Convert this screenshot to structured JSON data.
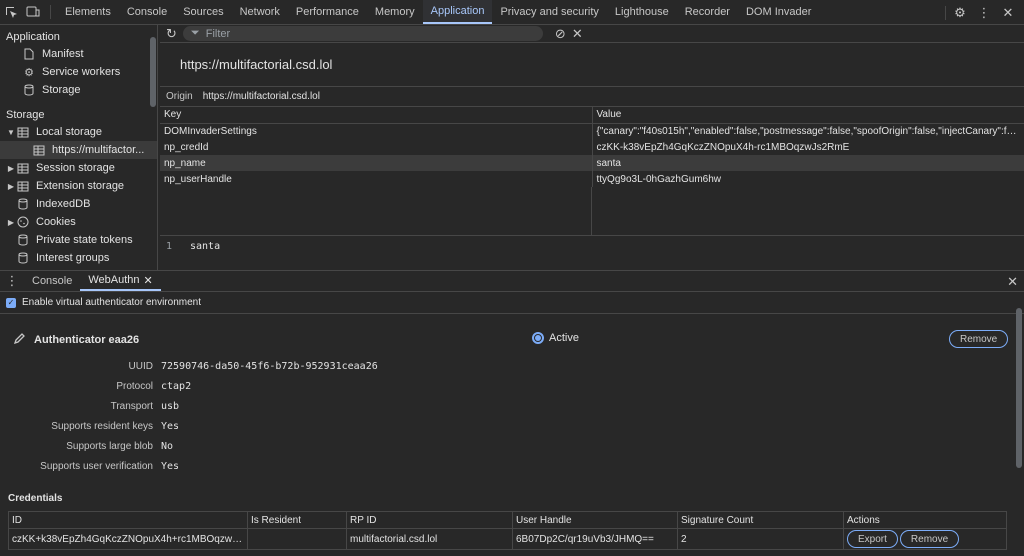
{
  "topbar": {
    "tabs": [
      "Elements",
      "Console",
      "Sources",
      "Network",
      "Performance",
      "Memory",
      "Application",
      "Privacy and security",
      "Lighthouse",
      "Recorder",
      "DOM Invader"
    ],
    "active_tab": "Application"
  },
  "sidebar": {
    "application_heading": "Application",
    "app_items": [
      "Manifest",
      "Service workers",
      "Storage"
    ],
    "storage_heading": "Storage",
    "local_storage": "Local storage",
    "local_storage_child": "https://multifactor...",
    "session_storage": "Session storage",
    "extension_storage": "Extension storage",
    "indexeddb": "IndexedDB",
    "cookies": "Cookies",
    "private_state_tokens": "Private state tokens",
    "interest_groups": "Interest groups"
  },
  "main": {
    "filter_placeholder": "Filter",
    "origin_url": "https://multifactorial.csd.lol",
    "origin_label": "Origin",
    "origin_value": "https://multifactorial.csd.lol",
    "col_key": "Key",
    "col_value": "Value",
    "rows": [
      {
        "key": "DOMInvaderSettings",
        "value": "{\"canary\":\"f40s015h\",\"enabled\":false,\"postmessage\":false,\"spoofOrigin\":false,\"injectCanary\":fals..."
      },
      {
        "key": "np_credId",
        "value": "czKK-k38vEpZh4GqKczZNOpuX4h-rc1MBOqzwJs2RmE"
      },
      {
        "key": "np_name",
        "value": "santa"
      },
      {
        "key": "np_userHandle",
        "value": "ttyQg9o3L-0hGazhGum6hw"
      }
    ],
    "preview_line": "1",
    "preview_text": "santa"
  },
  "drawer": {
    "tabs": [
      "Console",
      "WebAuthn"
    ],
    "active_tab": "WebAuthn",
    "enable_label": "Enable virtual authenticator environment",
    "authenticator_name": "Authenticator eaa26",
    "active_label": "Active",
    "remove_label": "Remove",
    "props": [
      {
        "k": "UUID",
        "v": "72590746-da50-45f6-b72b-952931ceaa26"
      },
      {
        "k": "Protocol",
        "v": "ctap2"
      },
      {
        "k": "Transport",
        "v": "usb"
      },
      {
        "k": "Supports resident keys",
        "v": "Yes"
      },
      {
        "k": "Supports large blob",
        "v": "No"
      },
      {
        "k": "Supports user verification",
        "v": "Yes"
      }
    ],
    "credentials_title": "Credentials",
    "cred_headers": [
      "ID",
      "Is Resident",
      "RP ID",
      "User Handle",
      "Signature Count",
      "Actions"
    ],
    "cred_row": {
      "id": "czKK+k38vEpZh4GqKczZNOpuX4h+rc1MBOqzwJs2...",
      "is_resident": "",
      "rp_id": "multifactorial.csd.lol",
      "user_handle": "6B07Dp2C/qr19uVb3/JHMQ==",
      "signature_count": "2",
      "export_label": "Export",
      "remove_label": "Remove"
    }
  }
}
